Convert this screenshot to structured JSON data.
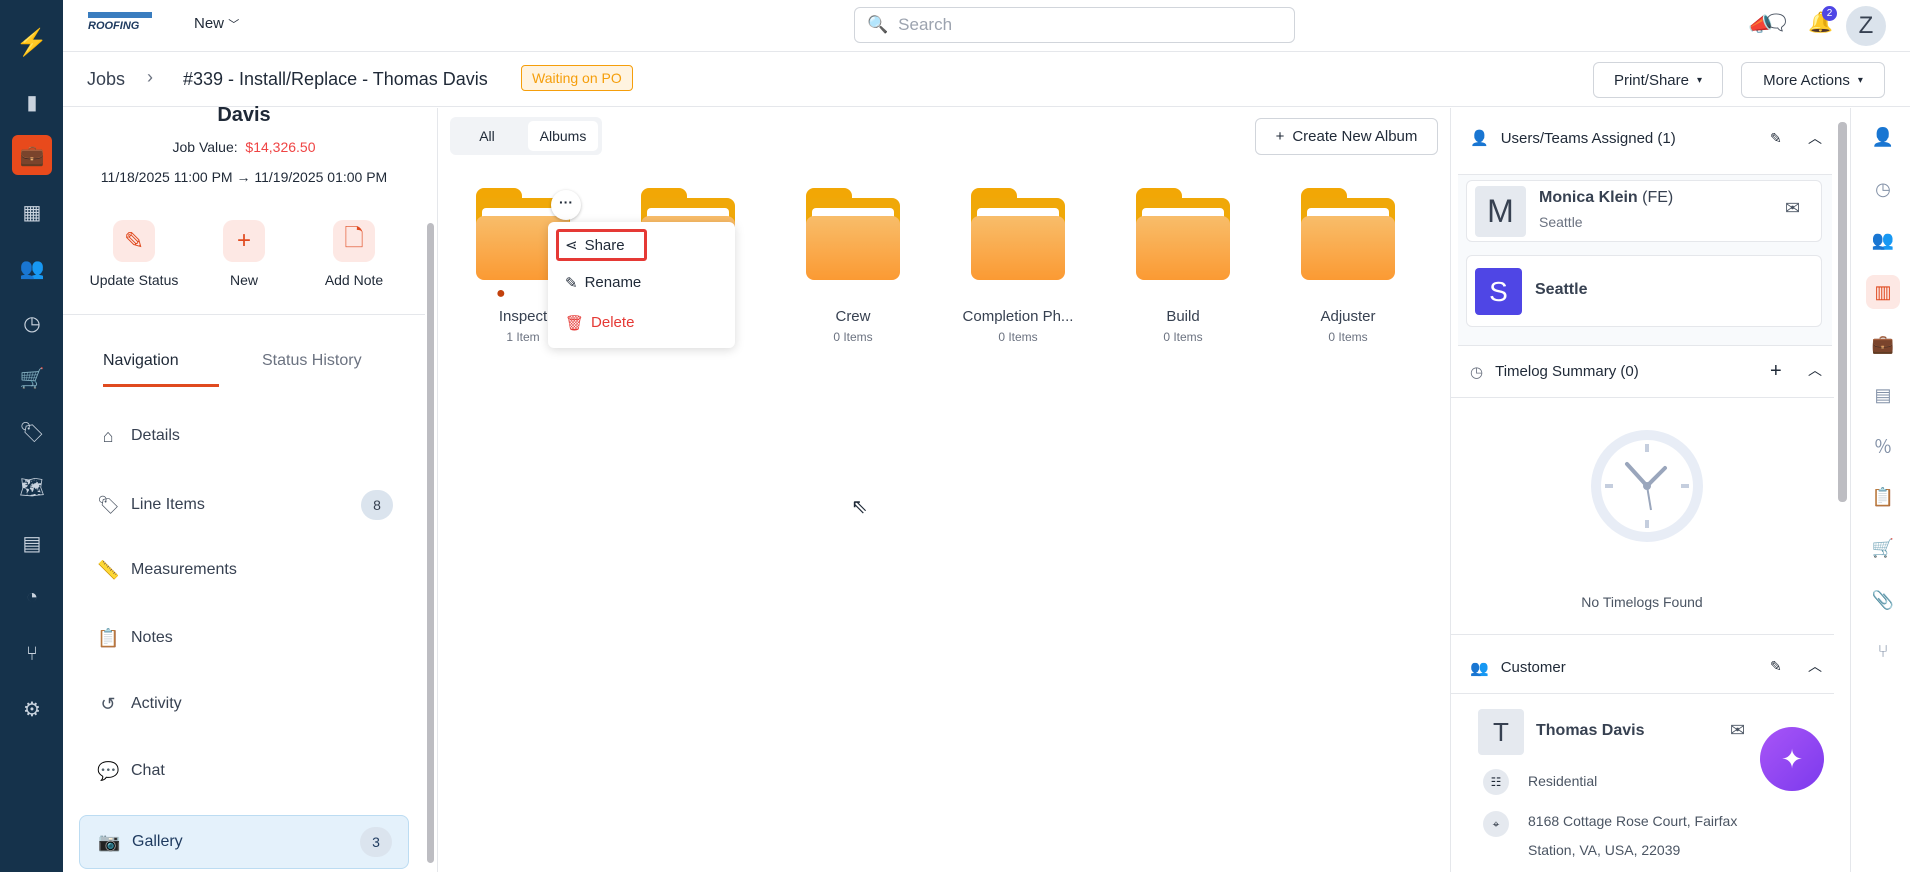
{
  "header": {
    "brand": "ROOFING",
    "new_label": "New",
    "search_placeholder": "Search",
    "notif_count": "2",
    "avatar": "Z"
  },
  "breadcrumb": {
    "root": "Jobs",
    "title": "#339 - Install/Replace - Thomas Davis",
    "status": "Waiting on PO",
    "print_share": "Print/Share",
    "more_actions": "More Actions"
  },
  "job": {
    "name": "Davis",
    "value_label": "Job Value:",
    "value": "$14,326.50",
    "dates": "11/18/2025 11:00 PM → 11/19/2025 01:00 PM"
  },
  "actions": [
    {
      "label": "Update Status"
    },
    {
      "label": "New"
    },
    {
      "label": "Add Note"
    }
  ],
  "tabs": {
    "navigation": "Navigation",
    "status_history": "Status History"
  },
  "nav": [
    {
      "label": "Details"
    },
    {
      "label": "Line Items",
      "badge": "8"
    },
    {
      "label": "Measurements"
    },
    {
      "label": "Notes"
    },
    {
      "label": "Activity"
    },
    {
      "label": "Chat"
    },
    {
      "label": "Gallery",
      "badge": "3"
    }
  ],
  "gallery": {
    "tab_all": "All",
    "tab_albums": "Albums",
    "create": "Create New Album",
    "folders": [
      {
        "name": "Inspect",
        "items": "1 Item"
      },
      {
        "name": "",
        "items": ""
      },
      {
        "name": "Crew",
        "items": "0 Items"
      },
      {
        "name": "Completion Ph...",
        "items": "0 Items"
      },
      {
        "name": "Build",
        "items": "0 Items"
      },
      {
        "name": "Adjuster",
        "items": "0 Items"
      }
    ],
    "menu": {
      "share": "Share",
      "rename": "Rename",
      "delete": "Delete"
    }
  },
  "right": {
    "users_title": "Users/Teams Assigned (1)",
    "user": {
      "initial": "M",
      "name": "Monica Klein",
      "role": "(FE)",
      "location": "Seattle"
    },
    "team": {
      "initial": "S",
      "name": "Seattle"
    },
    "timelog_title": "Timelog Summary (0)",
    "timelog_empty": "No Timelogs Found",
    "customer_title": "Customer",
    "customer": {
      "initial": "T",
      "name": "Thomas Davis",
      "type": "Residential",
      "address1": "8168 Cottage Rose Court, Fairfax",
      "address2": "Station, VA, USA, 22039"
    }
  },
  "colors": {
    "accent": "#e84a1c",
    "sidebar": "#15324b",
    "team": "#4f46e5"
  }
}
